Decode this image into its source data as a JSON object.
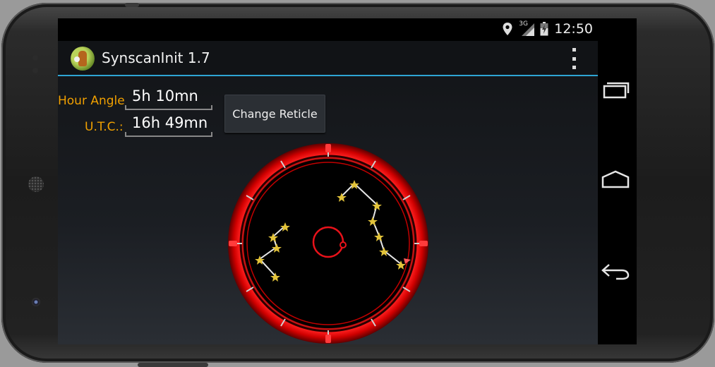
{
  "status_bar": {
    "network": "3G",
    "time": "12:50"
  },
  "action_bar": {
    "title": "SynscanInit 1.7",
    "app_icon": "app-logo-icon",
    "overflow_icon": "overflow-menu-icon"
  },
  "fields": {
    "hour_angle": {
      "label": "Hour Angle",
      "value": "5h 10mn"
    },
    "utc": {
      "label": "U.T.C.:",
      "value": "16h 49mn"
    }
  },
  "buttons": {
    "change_reticle": "Change Reticle"
  },
  "reticle": {
    "ring_color": "#e8121a",
    "star_color": "#e2c33a",
    "line_color": "#e6e6e6",
    "marker_color": "#ff5a5a"
  },
  "nav_bar": {
    "recents_icon": "recents-icon",
    "home_icon": "home-icon",
    "back_icon": "back-icon"
  }
}
